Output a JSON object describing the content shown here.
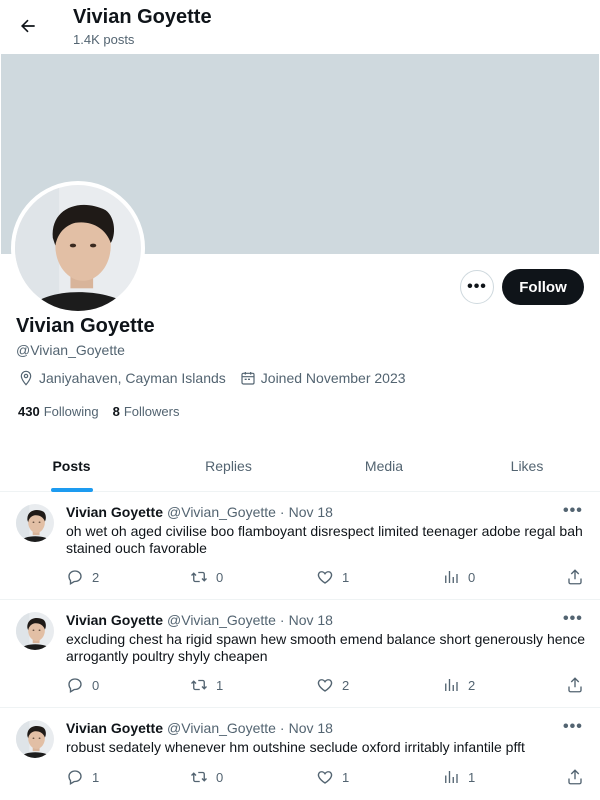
{
  "header": {
    "name": "Vivian Goyette",
    "posts_count": "1.4K posts"
  },
  "profile": {
    "name": "Vivian Goyette",
    "handle": "@Vivian_Goyette",
    "location": "Janiyahaven, Cayman Islands",
    "joined": "Joined November 2023",
    "following_count": "430",
    "following_label": "Following",
    "followers_count": "8",
    "followers_label": "Followers",
    "follow_label": "Follow",
    "more_label": "•••"
  },
  "tabs": [
    {
      "label": "Posts",
      "active": true
    },
    {
      "label": "Replies",
      "active": false
    },
    {
      "label": "Media",
      "active": false
    },
    {
      "label": "Likes",
      "active": false
    }
  ],
  "posts": [
    {
      "author": "Vivian Goyette",
      "handle": "@Vivian_Goyette",
      "dot": "·",
      "date": "Nov 18",
      "text": "oh wet oh aged civilise boo flamboyant disrespect limited teenager adobe regal bah stained ouch favorable",
      "replies": "2",
      "reposts": "0",
      "likes": "1",
      "views": "0"
    },
    {
      "author": "Vivian Goyette",
      "handle": "@Vivian_Goyette",
      "dot": "·",
      "date": "Nov 18",
      "text": "excluding chest ha rigid spawn hew smooth emend balance short generously hence arrogantly poultry shyly cheapen",
      "replies": "0",
      "reposts": "1",
      "likes": "2",
      "views": "2"
    },
    {
      "author": "Vivian Goyette",
      "handle": "@Vivian_Goyette",
      "dot": "·",
      "date": "Nov 18",
      "text": "robust sedately whenever hm outshine seclude oxford irritably infantile pfft",
      "replies": "1",
      "reposts": "0",
      "likes": "1",
      "views": "1"
    }
  ],
  "colors": {
    "accent": "#1d9bf0",
    "banner": "#cfd9de",
    "follow_bg": "#0f1419",
    "muted": "#536471"
  },
  "icons": [
    "back-arrow-icon",
    "location-icon",
    "calendar-icon",
    "reply-icon",
    "repost-icon",
    "like-icon",
    "views-icon",
    "share-icon"
  ]
}
